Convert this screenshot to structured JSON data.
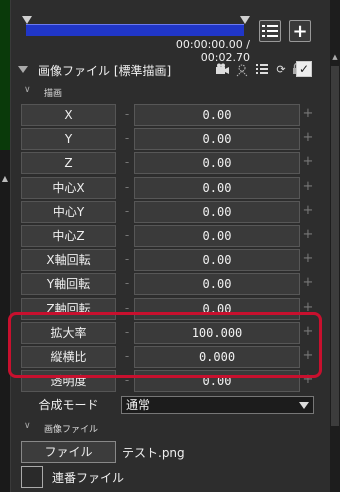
{
  "timeline": {
    "timecode": "00:00:00.00 / 00:02.70"
  },
  "toolbar": {
    "add_label": "+"
  },
  "object": {
    "title": "画像ファイル [標準描画]",
    "checkbox_mark": "✓"
  },
  "section_draw": {
    "label": "描画"
  },
  "rows": [
    {
      "label": "X",
      "value": "0.00"
    },
    {
      "label": "Y",
      "value": "0.00"
    },
    {
      "label": "Z",
      "value": "0.00"
    },
    {
      "label": "中心X",
      "value": "0.00"
    },
    {
      "label": "中心Y",
      "value": "0.00"
    },
    {
      "label": "中心Z",
      "value": "0.00"
    },
    {
      "label": "X軸回転",
      "value": "0.00"
    },
    {
      "label": "Y軸回転",
      "value": "0.00"
    },
    {
      "label": "Z軸回転",
      "value": "0.00"
    },
    {
      "label": "拡大率",
      "value": "100.000"
    },
    {
      "label": "縦横比",
      "value": "0.000"
    },
    {
      "label": "透明度",
      "value": "0.00"
    }
  ],
  "blend": {
    "label": "合成モード",
    "value": "通常"
  },
  "section_file": {
    "label": "画像ファイル"
  },
  "file": {
    "button_label": "ファイル",
    "name": "テスト.png",
    "sequence_label": "連番ファイル"
  },
  "colors": {
    "highlight": "#c8102e",
    "timeline_bar": "#2036c8"
  }
}
